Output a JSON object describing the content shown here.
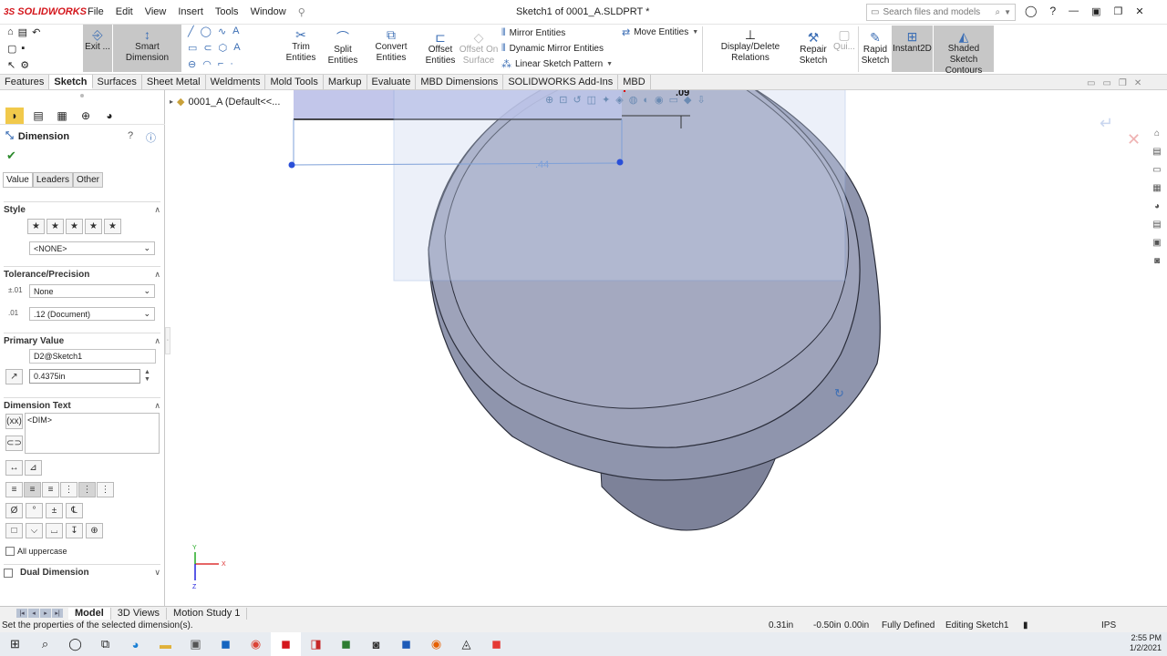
{
  "app": {
    "brand": "SOLIDWORKS",
    "ds": "3S",
    "doc_title": "Sketch1 of 0001_A.SLDPRT *"
  },
  "menus": [
    "File",
    "Edit",
    "View",
    "Insert",
    "Tools",
    "Window"
  ],
  "search": {
    "placeholder": "Search files and models"
  },
  "commands": {
    "exit_sketch": "Exit ...",
    "smart_dimension": "Smart Dimension",
    "trim": "Trim Entities",
    "split": "Split Entities",
    "convert": "Convert Entities",
    "offset": "Offset Entities",
    "offset_surface": "Offset On Surface",
    "mirror": "Mirror Entities",
    "dyn_mirror": "Dynamic Mirror Entities",
    "linear_pattern": "Linear Sketch Pattern",
    "move": "Move Entities",
    "relations": "Display/Delete Relations",
    "repair": "Repair Sketch",
    "quick": "Qui...",
    "rapid": "Rapid Sketch",
    "instant2d": "Instant2D",
    "shaded": "Shaded Sketch Contours"
  },
  "tabs": [
    "Features",
    "Sketch",
    "Surfaces",
    "Sheet Metal",
    "Weldments",
    "Mold Tools",
    "Markup",
    "Evaluate",
    "MBD Dimensions",
    "SOLIDWORKS Add-Ins",
    "MBD"
  ],
  "active_tab": "Sketch",
  "panel": {
    "title": "Dimension",
    "subtabs": [
      "Value",
      "Leaders",
      "Other"
    ],
    "style_label": "Style",
    "style_select": "<NONE>",
    "tolerance_label": "Tolerance/Precision",
    "tolerance_select": "None",
    "precision_select": ".12 (Document)",
    "primary_label": "Primary Value",
    "primary_name": "D2@Sketch1",
    "primary_value": "0.4375in",
    "dimtext_label": "Dimension Text",
    "dimtext_value": "<DIM>",
    "all_upper": "All uppercase",
    "dual": "Dual Dimension"
  },
  "tree": {
    "label": "0001_A  (Default<<..."
  },
  "viewport": {
    "dim_small": ".09",
    "dim_main": ".44",
    "axis_x": "X",
    "axis_y": "Y",
    "axis_z": "Z"
  },
  "bottom_tabs": [
    "Model",
    "3D Views",
    "Motion Study 1"
  ],
  "status": {
    "message": "Set the properties of the selected dimension(s).",
    "x": "0.31in",
    "y": "-0.50in",
    "z": "0.00in",
    "state": "Fully Defined",
    "editing": "Editing Sketch1",
    "units": "IPS"
  },
  "tray": {
    "time": "2:55 PM",
    "date": "1/2/2021"
  },
  "colors": {
    "accent": "#3d6fb5",
    "body": "#8e94ac",
    "face": "#a4a9c0",
    "brand": "#d4161c"
  }
}
